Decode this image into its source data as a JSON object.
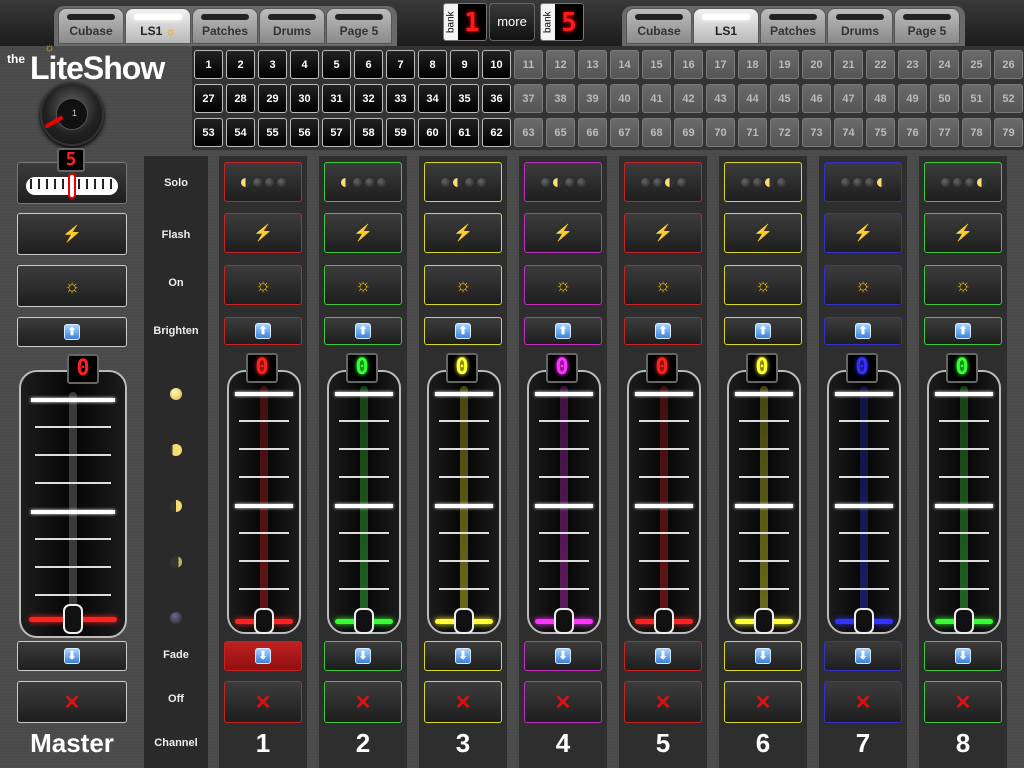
{
  "tabs_left": [
    {
      "label": "Cubase",
      "active": false
    },
    {
      "label": "LS1",
      "active": true,
      "icon": "sun-icon"
    },
    {
      "label": "Patches",
      "active": false
    },
    {
      "label": "Drums",
      "active": false
    },
    {
      "label": "Page 5",
      "active": false
    }
  ],
  "tabs_right": [
    {
      "label": "Cubase",
      "active": false
    },
    {
      "label": "LS1",
      "active": true
    },
    {
      "label": "Patches",
      "active": false
    },
    {
      "label": "Drums",
      "active": false
    },
    {
      "label": "Page 5",
      "active": false
    }
  ],
  "bank_left": {
    "label": "bank",
    "value": "1"
  },
  "bank_right": {
    "label": "bank",
    "value": "5"
  },
  "more_label": "more",
  "logo": {
    "the": "the",
    "name": "LiteShow",
    "knob_value": "1"
  },
  "patch_rows": [
    {
      "on": [
        "1",
        "2",
        "3",
        "4",
        "5",
        "6",
        "7",
        "8",
        "9",
        "10"
      ],
      "off": [
        "11",
        "12",
        "13",
        "14",
        "15",
        "16",
        "17",
        "18",
        "19",
        "20",
        "21",
        "22",
        "23",
        "24",
        "25",
        "26"
      ]
    },
    {
      "on": [
        "27",
        "28",
        "29",
        "30",
        "31",
        "32",
        "33",
        "34",
        "35",
        "36"
      ],
      "off": [
        "37",
        "38",
        "39",
        "40",
        "41",
        "42",
        "43",
        "44",
        "45",
        "46",
        "47",
        "48",
        "49",
        "50",
        "51",
        "52"
      ]
    },
    {
      "on": [
        "53",
        "54",
        "55",
        "56",
        "57",
        "58",
        "59",
        "60",
        "61",
        "62"
      ],
      "off": [
        "63",
        "65",
        "66",
        "67",
        "68",
        "69",
        "70",
        "71",
        "72",
        "73",
        "74",
        "75",
        "76",
        "77",
        "78",
        "79"
      ]
    }
  ],
  "master": {
    "top_display": "5",
    "level": "0",
    "label": "Master"
  },
  "row_labels": {
    "solo": "Solo",
    "flash": "Flash",
    "on": "On",
    "brighten": "Brighten",
    "fade": "Fade",
    "off": "Off",
    "channel": "Channel"
  },
  "channels": [
    {
      "number": "1",
      "level": "0",
      "color": "#ff2020",
      "border": "#c82424",
      "solo_lit": 0,
      "fade_active": true
    },
    {
      "number": "2",
      "level": "0",
      "color": "#33ff33",
      "border": "#3ec83e",
      "solo_lit": 0,
      "fade_active": false
    },
    {
      "number": "3",
      "level": "0",
      "color": "#ffff33",
      "border": "#d8d82a",
      "solo_lit": 1,
      "fade_active": false
    },
    {
      "number": "4",
      "level": "0",
      "color": "#ff33ff",
      "border": "#c030c0",
      "solo_lit": 1,
      "fade_active": false
    },
    {
      "number": "5",
      "level": "0",
      "color": "#ff2020",
      "border": "#c82424",
      "solo_lit": 2,
      "fade_active": false
    },
    {
      "number": "6",
      "level": "0",
      "color": "#ffff33",
      "border": "#d8d82a",
      "solo_lit": 2,
      "fade_active": false
    },
    {
      "number": "7",
      "level": "0",
      "color": "#3333ff",
      "border": "#3232c8",
      "solo_lit": 3,
      "fade_active": false
    },
    {
      "number": "8",
      "level": "0",
      "color": "#33ff33",
      "border": "#3ec83e",
      "solo_lit": 3,
      "fade_active": false
    }
  ],
  "icons": {
    "flash": "⚡",
    "sun": "☼",
    "up": "⬆",
    "down": "⬇",
    "x": "✕"
  }
}
